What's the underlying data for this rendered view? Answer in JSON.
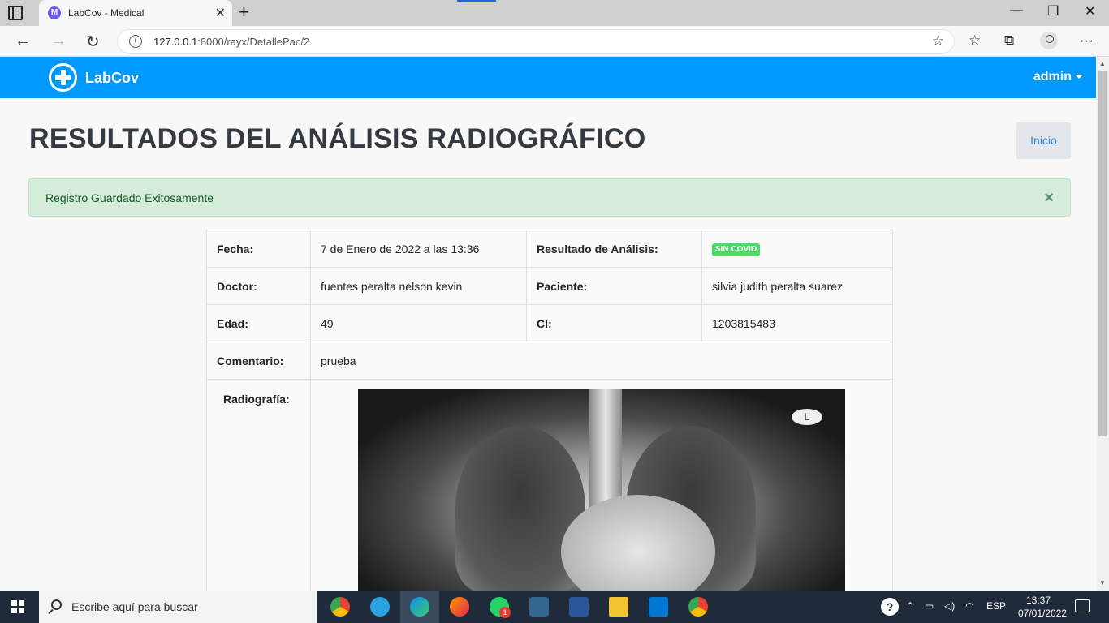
{
  "browser": {
    "tab_title": "LabCov - Medical",
    "url_host": "127.0.0.1",
    "url_path": ":8000/rayx/DetallePac/2"
  },
  "app": {
    "brand": "LabCov",
    "user": "admin"
  },
  "page": {
    "title": "RESULTADOS DEL ANÁLISIS RADIOGRÁFICO",
    "inicio_button": "Inicio",
    "alert_message": "Registro Guardado Exitosamente",
    "alert_close": "×"
  },
  "details": {
    "fecha_label": "Fecha:",
    "fecha_value": "7 de Enero de 2022 a las 13:36",
    "resultado_label": "Resultado de Análisis:",
    "resultado_value": "SIN COVID",
    "doctor_label": "Doctor:",
    "doctor_value": "fuentes peralta nelson kevin",
    "paciente_label": "Paciente:",
    "paciente_value": "silvia judith peralta suarez",
    "edad_label": "Edad:",
    "edad_value": "49",
    "ci_label": "CI:",
    "ci_value": "1203815483",
    "comentario_label": "Comentario:",
    "comentario_value": "prueba",
    "radiografia_label": "Radiografía:",
    "xray_marker": "L"
  },
  "taskbar": {
    "search_placeholder": "Escribe aquí para buscar",
    "language": "ESP",
    "time": "13:37",
    "date": "07/01/2022",
    "whatsapp_badge": "1"
  },
  "colors": {
    "navbar": "#0099ff",
    "badge_success": "#4cd964",
    "alert_bg": "#d4edda"
  }
}
